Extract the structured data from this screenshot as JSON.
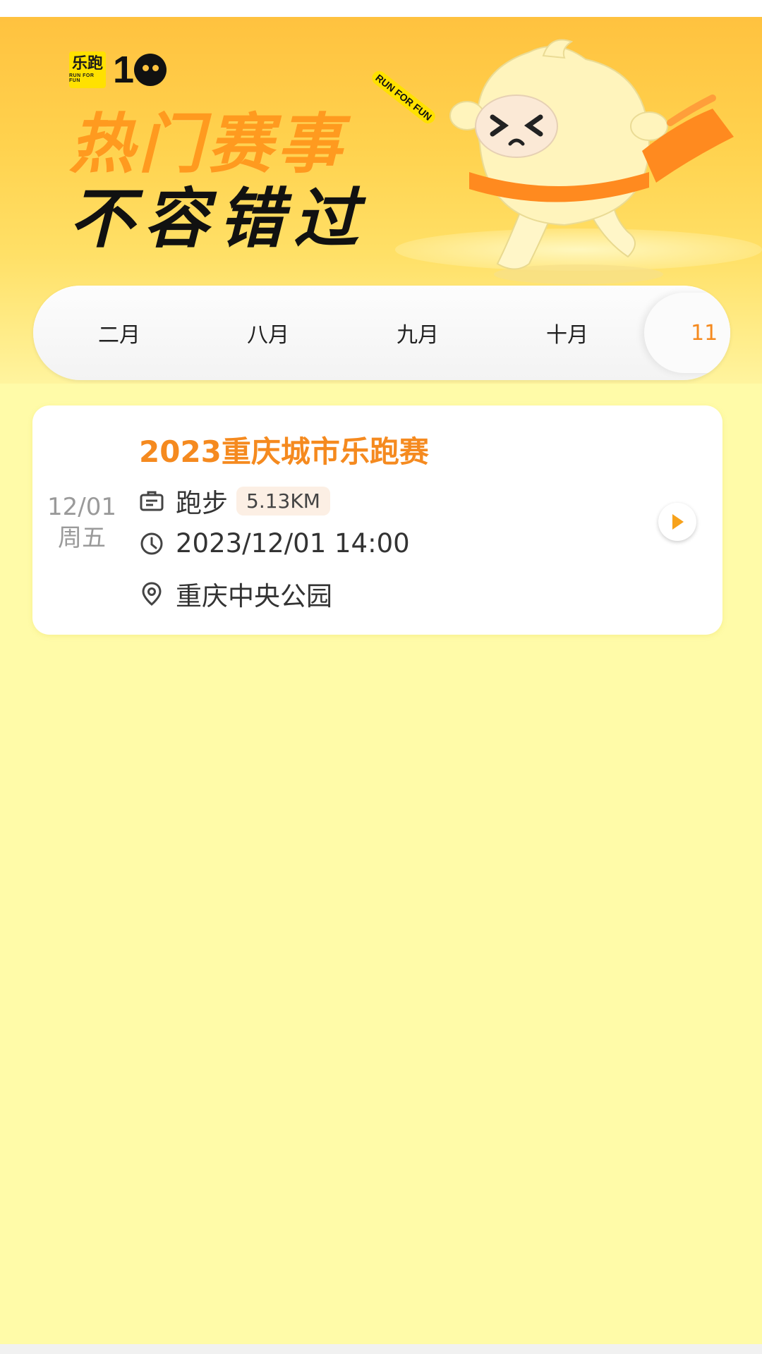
{
  "hero": {
    "logo_badge": "乐跑",
    "logo_badge_small": "RUN FOR FUN",
    "logo_number": "1",
    "headline_line1": "热门赛事",
    "headline_line2": "不容错过",
    "tag": "RUN FOR FUN"
  },
  "months": {
    "tabs": [
      "二月",
      "八月",
      "九月",
      "十月"
    ],
    "active": "11"
  },
  "event": {
    "date": "12/01",
    "weekday": "周五",
    "title": "2023重庆城市乐跑赛",
    "sport": "跑步",
    "distance": "5.13KM",
    "datetime": "2023/12/01 14:00",
    "location": "重庆中央公园"
  },
  "colors": {
    "accent": "#F58A1F",
    "background": "#FFFBA8",
    "hero_top": "#FFC23F"
  },
  "icons": {
    "sport": "ticket-icon",
    "time": "clock-icon",
    "location": "location-pin-icon",
    "action": "play-icon"
  }
}
